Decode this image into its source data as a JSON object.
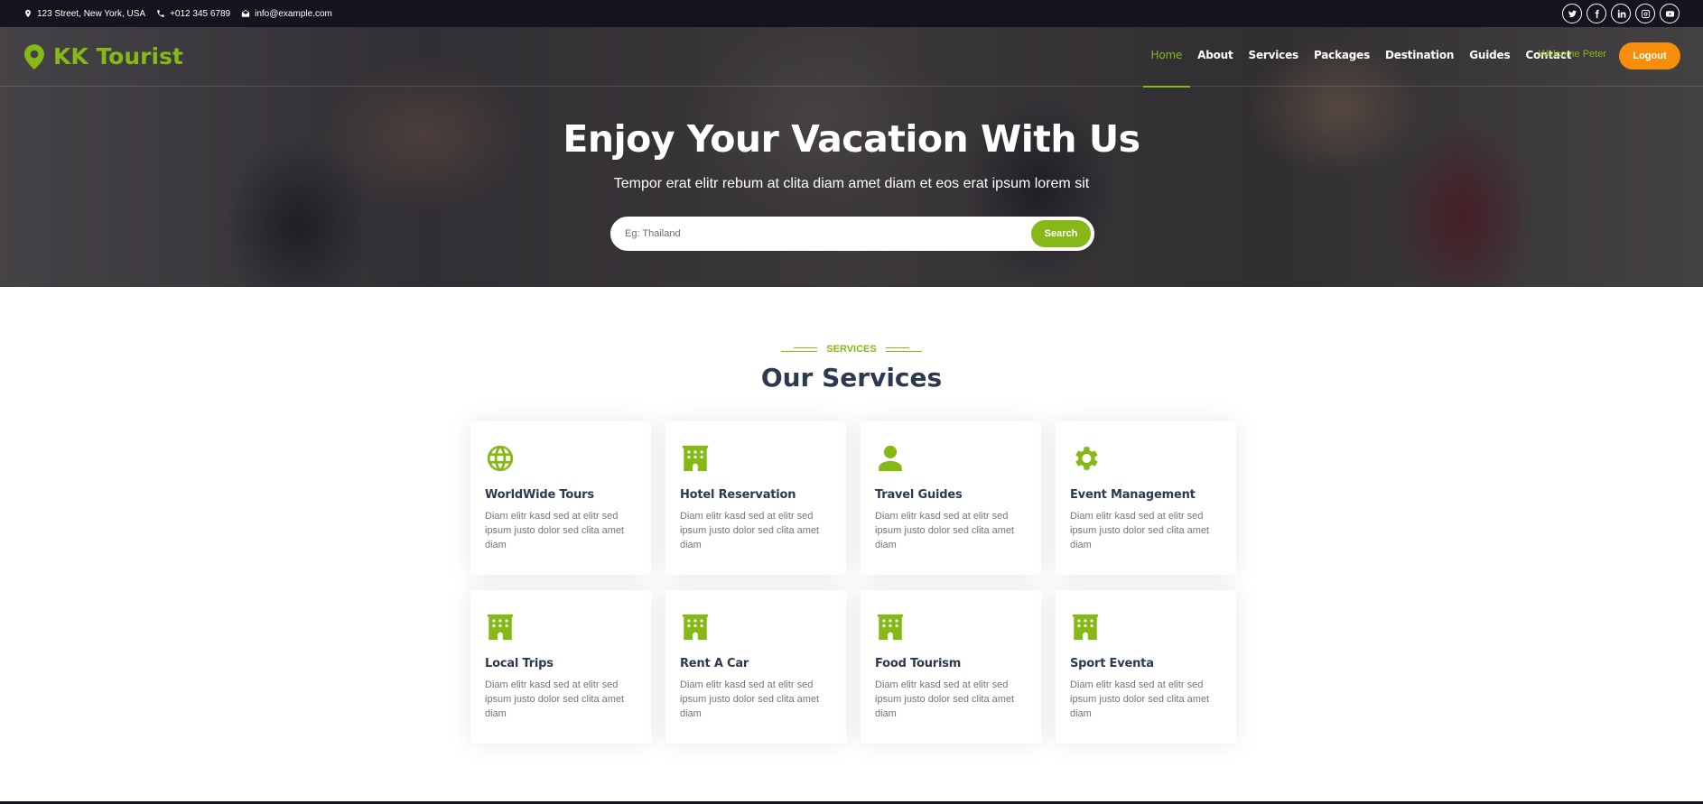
{
  "topbar": {
    "address": "123 Street, New York, USA",
    "phone": "+012 345 6789",
    "email": "info@example.com",
    "socials": [
      "twitter-icon",
      "facebook-icon",
      "linkedin-icon",
      "instagram-icon",
      "youtube-icon"
    ]
  },
  "nav": {
    "brand": "KK Tourist",
    "items": [
      {
        "label": "Home",
        "active": true
      },
      {
        "label": "About"
      },
      {
        "label": "Services"
      },
      {
        "label": "Packages"
      },
      {
        "label": "Destination"
      },
      {
        "label": "Guides"
      },
      {
        "label": "Contact"
      }
    ],
    "welcome": "Welcome Peter",
    "logout_label": "Logout"
  },
  "hero": {
    "title": "Enjoy Your Vacation With Us",
    "subtitle": "Tempor erat elitr rebum at clita diam amet diam et eos erat ipsum lorem sit",
    "search": {
      "placeholder": "Eg: Thailand",
      "value": "",
      "button_label": "Search"
    }
  },
  "services": {
    "tag": "SERVICES",
    "title": "Our Services",
    "items": [
      {
        "title": "WorldWide Tours",
        "description": "Diam elitr kasd sed at elitr sed ipsum justo dolor sed clita amet diam",
        "icon": "globe-icon"
      },
      {
        "title": "Hotel Reservation",
        "description": "Diam elitr kasd sed at elitr sed ipsum justo dolor sed clita amet diam",
        "icon": "hotel-icon"
      },
      {
        "title": "Travel Guides",
        "description": "Diam elitr kasd sed at elitr sed ipsum justo dolor sed clita amet diam",
        "icon": "user-icon"
      },
      {
        "title": "Event Management",
        "description": "Diam elitr kasd sed at elitr sed ipsum justo dolor sed clita amet diam",
        "icon": "cog-icon"
      },
      {
        "title": "Local Trips",
        "description": "Diam elitr kasd sed at elitr sed ipsum justo dolor sed clita amet diam",
        "icon": "hotel-icon"
      },
      {
        "title": "Rent A Car",
        "description": "Diam elitr kasd sed at elitr sed ipsum justo dolor sed clita amet diam",
        "icon": "hotel-icon"
      },
      {
        "title": "Food Tourism",
        "description": "Diam elitr kasd sed at elitr sed ipsum justo dolor sed clita amet diam",
        "icon": "hotel-icon"
      },
      {
        "title": "Sport Eventa",
        "description": "Diam elitr kasd sed at elitr sed ipsum justo dolor sed clita amet diam",
        "icon": "hotel-icon"
      }
    ]
  },
  "colors": {
    "accent": "#86b817",
    "logout": "#f78e0b",
    "topbar": "#14141f",
    "heading": "#2c3a4f"
  }
}
